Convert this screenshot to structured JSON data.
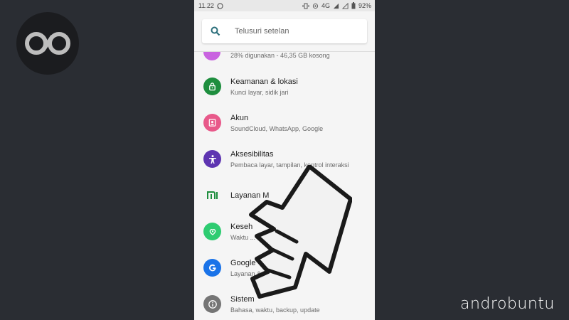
{
  "statusbar": {
    "time": "11.22",
    "network": "4G",
    "battery": "92%"
  },
  "search": {
    "placeholder": "Telusuri setelan"
  },
  "settings": {
    "partial_subtitle": "28% digunakan - 46,35 GB kosong",
    "items": [
      {
        "title": "Keamanan & lokasi",
        "subtitle": "Kunci layar, sidik jari",
        "icon": "lock-icon",
        "color": "#1e8e3e"
      },
      {
        "title": "Akun",
        "subtitle": "SoundCloud, WhatsApp, Google",
        "icon": "account-icon",
        "color": "#e8598a"
      },
      {
        "title": "Aksesibilitas",
        "subtitle": "Pembaca layar, tampilan, kontrol interaksi",
        "icon": "accessibility-icon",
        "color": "#5e35b1"
      },
      {
        "title": "Layanan M",
        "subtitle": "",
        "icon": "mi-icon",
        "color": "#1e8e3e"
      },
      {
        "title": "Keseh",
        "subtitle": "Waktu ... aplika...",
        "icon": "wellbeing-icon",
        "color": "#2ecc71"
      },
      {
        "title": "Google",
        "subtitle": "Layanan &...",
        "icon": "google-icon",
        "color": "#1a73e8"
      },
      {
        "title": "Sistem",
        "subtitle": "Bahasa, waktu, backup, update",
        "icon": "info-icon",
        "color": "#757575"
      }
    ]
  },
  "watermark": "androbuntu"
}
